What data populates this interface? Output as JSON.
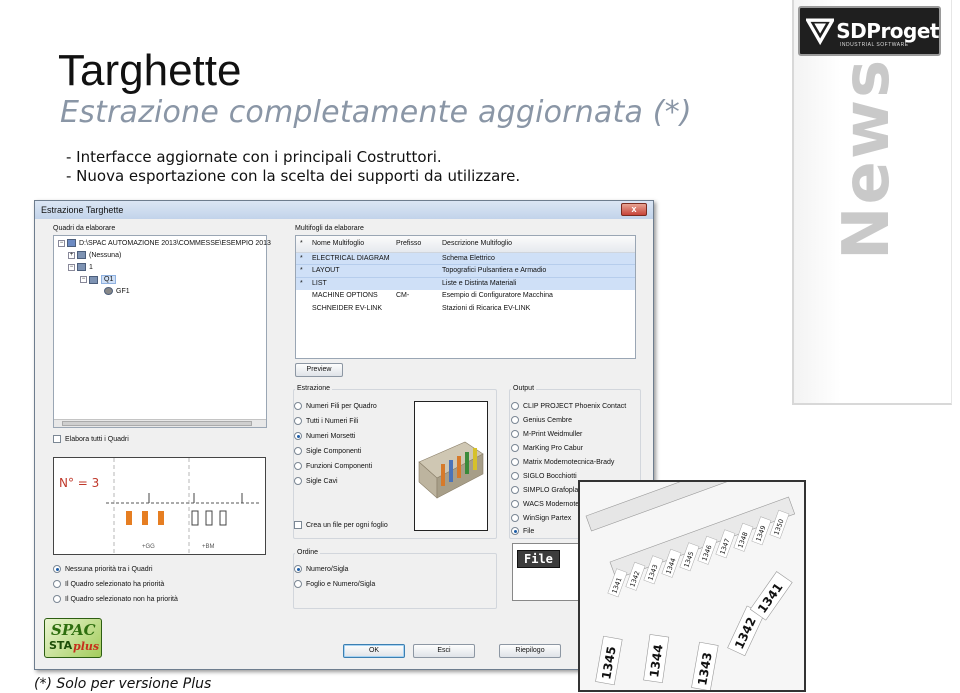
{
  "slide": {
    "title": "Targhette",
    "subtitle": "Estrazione completamente aggiornata (*)",
    "bullets": [
      "- Interfacce aggiornate con i principali Costruttori.",
      "- Nuova esportazione con la scelta dei supporti da utilizzare."
    ],
    "footnote": "(*) Solo per versione Plus"
  },
  "brand": {
    "logo_text": "SDProget",
    "logo_sub": "INDUSTRIAL SOFTWARE",
    "side_word": "News"
  },
  "dialog": {
    "title": "Estrazione Targhette",
    "close_glyph": "x",
    "quadri_label": "Quadri da elaborare",
    "tree": [
      {
        "text": "D:\\SPAC AUTOMAZIONE 2013\\COMMESSE\\ESEMPIO 2013",
        "toggle": "−"
      },
      {
        "text": "(Nessuna)",
        "toggle": "+"
      },
      {
        "text": "1",
        "toggle": "−"
      },
      {
        "text": "Q1",
        "toggle": "−"
      },
      {
        "text": "GF1",
        "toggle": ""
      }
    ],
    "elabora_tutti": "Elabora tutti i Quadri",
    "schematic_label": "N° = 3",
    "schematic_tags": [
      "+GG",
      "+BM"
    ],
    "priority_options": [
      {
        "label": "Nessuna priorità tra i Quadri",
        "selected": true
      },
      {
        "label": "Il Quadro selezionato ha priorità",
        "selected": false
      },
      {
        "label": "Il Quadro selezionato non ha priorità",
        "selected": false
      }
    ],
    "multifogli_label": "Multifogli da elaborare",
    "table": {
      "columns": [
        "Nome Multifoglio",
        "Prefisso",
        "Descrizione Multifoglio"
      ],
      "rows": [
        {
          "mark": "*",
          "name": "ELECTRICAL DIAGRAM",
          "prefix": "",
          "desc": "Schema Elettrico",
          "highlight": true
        },
        {
          "mark": "*",
          "name": "LAYOUT",
          "prefix": "",
          "desc": "Topografici Pulsantiera e Armadio",
          "highlight": true
        },
        {
          "mark": "*",
          "name": "LIST",
          "prefix": "",
          "desc": "Liste e Distinta Materiali",
          "highlight": true
        },
        {
          "mark": "",
          "name": "MACHINE OPTIONS",
          "prefix": "CM-",
          "desc": "Esempio di Configuratore Macchina",
          "highlight": false
        },
        {
          "mark": "",
          "name": "SCHNEIDER EV-LINK",
          "prefix": "",
          "desc": "Stazioni di Ricarica EV-LINK",
          "highlight": false
        }
      ]
    },
    "preview_button": "Preview",
    "estrazione_label": "Estrazione",
    "estrazione_options": [
      {
        "label": "Numeri Fili per Quadro",
        "selected": false
      },
      {
        "label": "Tutti i Numeri Fili",
        "selected": false
      },
      {
        "label": "Numeri Morsetti",
        "selected": true
      },
      {
        "label": "Sigle Componenti",
        "selected": false
      },
      {
        "label": "Funzioni Componenti",
        "selected": false
      },
      {
        "label": "Sigle Cavi",
        "selected": false
      }
    ],
    "crea_file": "Crea un file per ogni foglio",
    "ordine_label": "Ordine",
    "ordine_options": [
      {
        "label": "Numero/Sigla",
        "selected": true
      },
      {
        "label": "Foglio e Numero/Sigla",
        "selected": false
      }
    ],
    "output_label": "Output",
    "output_options": [
      {
        "label": "CLIP PROJECT Phoenix Contact",
        "selected": false
      },
      {
        "label": "Genius Cembre",
        "selected": false
      },
      {
        "label": "M-Print Weidmuller",
        "selected": false
      },
      {
        "label": "MarKing Pro Cabur",
        "selected": false
      },
      {
        "label": "Matrix Modernotecnica-Brady",
        "selected": false
      },
      {
        "label": "SIGLO Bocchiotti",
        "selected": false
      },
      {
        "label": "SIMPLO Grafoplast",
        "selected": false
      },
      {
        "label": "WACS Modernotecnica",
        "selected": false
      },
      {
        "label": "WinSign Partex",
        "selected": false
      },
      {
        "label": "File",
        "selected": true
      }
    ],
    "file_tab": "File",
    "buttons": {
      "ok": "OK",
      "esci": "Esci",
      "riepilogo": "Riepilogo"
    }
  },
  "spac_logo": {
    "line1": "SPAC",
    "line2": "STA",
    "plus": "plus"
  },
  "labels_photo": {
    "tags": [
      "1345",
      "1344",
      "1343",
      "1342",
      "1341"
    ],
    "small_tags": [
      "1341",
      "1342",
      "1343",
      "1344",
      "1345",
      "1346",
      "1347",
      "1348",
      "1349",
      "1350"
    ]
  },
  "colors": {
    "accent": "#1e5ea8",
    "highlight_row": "#cfe0f7",
    "subtitle": "#8a96a6",
    "news_word": "#c9c9c9"
  }
}
